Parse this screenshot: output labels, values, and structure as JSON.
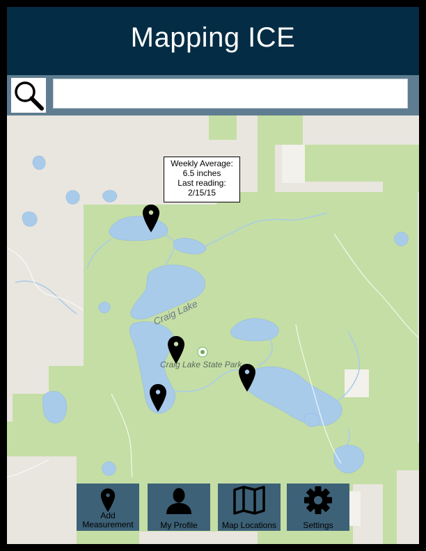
{
  "app": {
    "title": "Mapping ICE"
  },
  "search": {
    "value": "",
    "placeholder": ""
  },
  "map": {
    "labels": {
      "lake": "Craig Lake",
      "park": "Craig Lake State Park"
    },
    "tooltip": {
      "line1": "Weekly Average:",
      "line2": "6.5 inches",
      "line3": "Last reading:",
      "line4": "2/15/15"
    }
  },
  "nav": [
    {
      "label": "Add Measurement",
      "icon": "map-pin-icon"
    },
    {
      "label": "My Profile",
      "icon": "user-icon"
    },
    {
      "label": "Map Locations",
      "icon": "folded-map-icon"
    },
    {
      "label": "Settings",
      "icon": "gear-icon"
    }
  ],
  "colors": {
    "header": "#042c44",
    "search_bar": "#5f7d90",
    "nav_button": "#3d6177",
    "park_green": "#c5dea5",
    "water": "#a8cbea",
    "land": "#e9e6df"
  }
}
